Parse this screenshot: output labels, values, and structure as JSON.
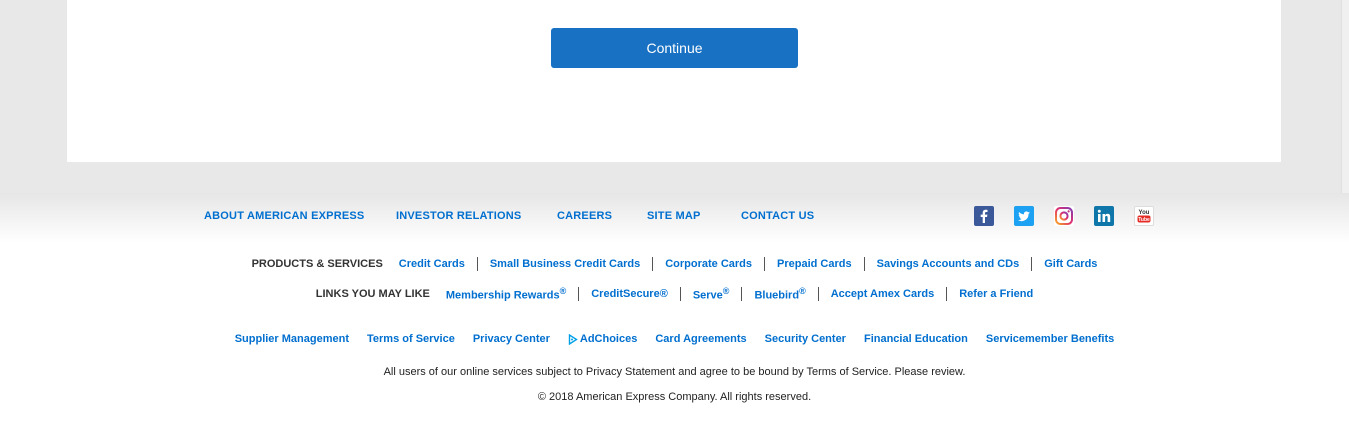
{
  "form": {
    "continue_label": "Continue"
  },
  "topnav": {
    "about": "ABOUT AMERICAN EXPRESS",
    "investor": "INVESTOR RELATIONS",
    "careers": "CAREERS",
    "sitemap": "SITE MAP",
    "contact": "CONTACT US"
  },
  "social": {
    "icons": [
      "facebook-icon",
      "twitter-icon",
      "instagram-icon",
      "linkedin-icon",
      "youtube-icon"
    ]
  },
  "products": {
    "label": "PRODUCTS & SERVICES",
    "links": [
      "Credit Cards",
      "Small Business Credit Cards",
      "Corporate Cards",
      "Prepaid Cards",
      "Savings Accounts and CDs",
      "Gift Cards"
    ]
  },
  "links_may_like": {
    "label": "LINKS YOU MAY LIKE",
    "membership": "Membership Rewards",
    "creditsecure": "CreditSecure®",
    "serve": "Serve",
    "bluebird": "Bluebird",
    "accept": "Accept Amex Cards",
    "refer": "Refer a Friend",
    "registered": "®"
  },
  "bottom_links": {
    "supplier": "Supplier Management",
    "terms": "Terms of Service",
    "privacy": "Privacy Center",
    "adchoices": "AdChoices",
    "card_agreements": "Card Agreements",
    "security": "Security Center",
    "financial": "Financial Education",
    "servicemember": "Servicemember Benefits"
  },
  "legal": {
    "notice": "All users of our online services subject to Privacy Statement and agree to be bound by Terms of Service. Please review.",
    "copyright": "© 2018 American Express Company. All rights reserved."
  },
  "colors": {
    "link": "#006fcf",
    "button": "#1871c2",
    "background": "#e8e8e8"
  }
}
